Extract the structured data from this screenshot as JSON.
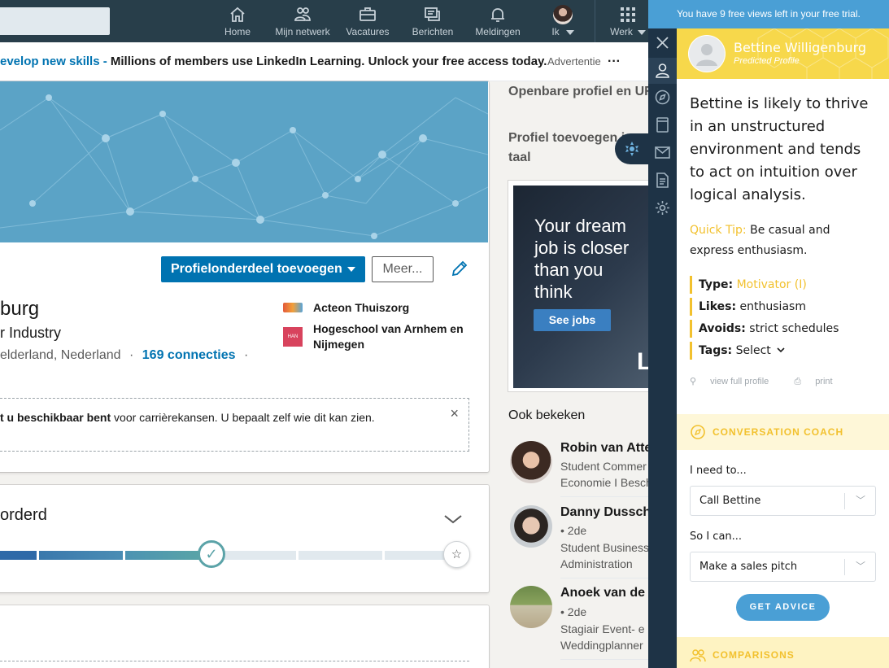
{
  "nav": {
    "items": [
      {
        "label": "Home",
        "icon": "home-icon"
      },
      {
        "label": "Mijn netwerk",
        "icon": "network-icon"
      },
      {
        "label": "Vacatures",
        "icon": "briefcase-icon"
      },
      {
        "label": "Berichten",
        "icon": "messages-icon"
      },
      {
        "label": "Meldingen",
        "icon": "bell-icon"
      },
      {
        "label": "Ik",
        "icon": "avatar"
      },
      {
        "label": "Werk",
        "icon": "grid-icon"
      }
    ]
  },
  "ad_bar": {
    "link_text": "evelop new skills -",
    "message": "Millions of members use LinkedIn Learning. Unlock your free access today.",
    "tag": "Advertentie",
    "more": "···"
  },
  "profile": {
    "add_section_button": "Profielonderdeel toevoegen",
    "more_button": "Meer...",
    "name": "burg",
    "headline": "r Industry",
    "location": "elderland, Nederland",
    "separator": "·",
    "connections": "169 connecties",
    "trailing_dot": "·",
    "experience": [
      {
        "name": "Acteon Thuiszorg"
      },
      {
        "name": "Hogeschool van Arnhem en Nijmegen",
        "logo_text": "HAN"
      }
    ],
    "availability": {
      "bold": "t u beschikbaar bent",
      "text": " voor carrièrekansen. U bepaalt zelf wie dit kan zien.",
      "close": "×"
    }
  },
  "strength": {
    "title": "orderd"
  },
  "sidebar": {
    "public_profile": "Openbare profiel en URL",
    "add_profile_lang_1": "Profiel toevoegen in",
    "add_profile_lang_2": "taal",
    "ad": {
      "line1": "Your dream",
      "line2": "job is closer",
      "line3": "than you",
      "line4": "think",
      "button": "See jobs",
      "logo_letter": "L"
    },
    "also_viewed_title": "Ook bekeken",
    "people": [
      {
        "name": "Robin van Atte",
        "desc1": "Student Commer",
        "desc2": "Economie I Besch"
      },
      {
        "name": "Danny Dussch",
        "degree": "• 2de",
        "desc1": "Student Business",
        "desc2": "Administration"
      },
      {
        "name": "Anoek van de S",
        "degree": "• 2de",
        "desc1": "Stagiair Event- e",
        "desc2": "Weddingplanner"
      }
    ]
  },
  "crystal": {
    "trial_banner": "You have 9 free views left in your free trial.",
    "person_name": "Bettine Willigenburg",
    "profile_type": "Predicted Profile",
    "description": "Bettine is likely to thrive in an unstructured environment and tends to act on intuition over logical analysis.",
    "quick_tip_label": "Quick Tip:",
    "quick_tip": " Be casual and express enthusiasm.",
    "traits": [
      {
        "label": "Type:",
        "value": " Motivator (I)"
      },
      {
        "label": "Likes:",
        "value": " enthusiasm"
      },
      {
        "label": "Avoids:",
        "value": " strict schedules"
      },
      {
        "label": "Tags:",
        "value": " Select"
      }
    ],
    "view_full_profile": "view full profile",
    "print": "print",
    "coach_title": "CONVERSATION COACH",
    "need_to_label": "I need to...",
    "need_to_value": "Call Bettine",
    "so_i_can_label": "So I can...",
    "so_i_can_value": "Make a sales pitch",
    "get_advice": "GET ADVICE",
    "comparisons_title": "COMPARISONS"
  },
  "colors": {
    "linkedin_blue": "#0073b1",
    "nav_bg": "#283e4a",
    "crystal_yellow": "#f2c12e",
    "crystal_blue": "#4a9fd5"
  }
}
